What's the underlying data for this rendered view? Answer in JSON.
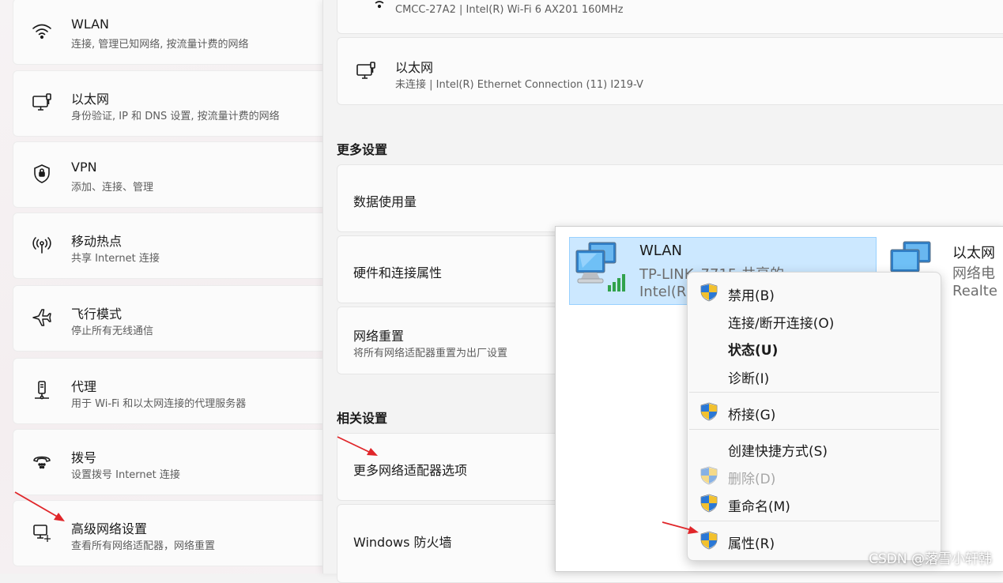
{
  "left_panel": {
    "items": [
      {
        "title": "WLAN",
        "subtitle": "连接, 管理已知网络, 按流量计费的网络",
        "icon": "wifi-icon"
      },
      {
        "title": "以太网",
        "subtitle": "身份验证, IP 和 DNS 设置, 按流量计费的网络",
        "icon": "ethernet-icon"
      },
      {
        "title": "VPN",
        "subtitle": "添加、连接、管理",
        "icon": "shield-icon"
      },
      {
        "title": "移动热点",
        "subtitle": "共享 Internet 连接",
        "icon": "hotspot-icon"
      },
      {
        "title": "飞行模式",
        "subtitle": "停止所有无线通信",
        "icon": "airplane-icon"
      },
      {
        "title": "代理",
        "subtitle": "用于 Wi-Fi 和以太网连接的代理服务器",
        "icon": "proxy-icon"
      },
      {
        "title": "拨号",
        "subtitle": "设置拨号 Internet 连接",
        "icon": "dialup-icon"
      },
      {
        "title": "高级网络设置",
        "subtitle": "查看所有网络适配器，网络重置",
        "icon": "advanced-network-icon"
      }
    ]
  },
  "middle_panel": {
    "wifi_card": {
      "subtitle": "CMCC-27A2 | Intel(R) Wi-Fi 6 AX201 160MHz"
    },
    "ethernet_card": {
      "title": "以太网",
      "subtitle": "未连接 | Intel(R) Ethernet Connection (11) I219-V"
    },
    "more_settings": {
      "heading": "更多设置",
      "items": [
        {
          "title": "数据使用量"
        },
        {
          "title": "硬件和连接属性"
        },
        {
          "title": "网络重置",
          "subtitle": "将所有网络适配器重置为出厂设置"
        }
      ]
    },
    "related_settings": {
      "heading": "相关设置",
      "items": [
        {
          "title": "更多网络适配器选项"
        },
        {
          "title": "Windows 防火墙"
        }
      ]
    }
  },
  "network_connections": {
    "adapters": [
      {
        "name": "WLAN",
        "line2": "TP-LINK_7715  共享的",
        "line3": "Intel(R",
        "selected": true
      },
      {
        "name": "以太网",
        "line2": "网络电",
        "line3": "Realte",
        "selected": false
      }
    ]
  },
  "context_menu": {
    "items": [
      {
        "label": "禁用(B)",
        "shield": true,
        "disabled": false,
        "bold": false
      },
      {
        "label": "连接/断开连接(O)",
        "shield": false,
        "disabled": false,
        "bold": false
      },
      {
        "label": "状态(U)",
        "shield": false,
        "disabled": false,
        "bold": true
      },
      {
        "label": "诊断(I)",
        "shield": false,
        "disabled": false,
        "bold": false
      },
      {
        "label": "桥接(G)",
        "shield": true,
        "disabled": false,
        "bold": false
      },
      {
        "label": "创建快捷方式(S)",
        "shield": false,
        "disabled": false,
        "bold": false
      },
      {
        "label": "删除(D)",
        "shield": true,
        "disabled": true,
        "bold": false
      },
      {
        "label": "重命名(M)",
        "shield": true,
        "disabled": false,
        "bold": false
      },
      {
        "label": "属性(R)",
        "shield": true,
        "disabled": false,
        "bold": false
      }
    ]
  },
  "watermark": "CSDN @落雪小轩韩",
  "colors": {
    "annotation_arrow": "#e0262a",
    "selection_bg": "#cce8ff",
    "selection_border": "#99d1ff"
  }
}
